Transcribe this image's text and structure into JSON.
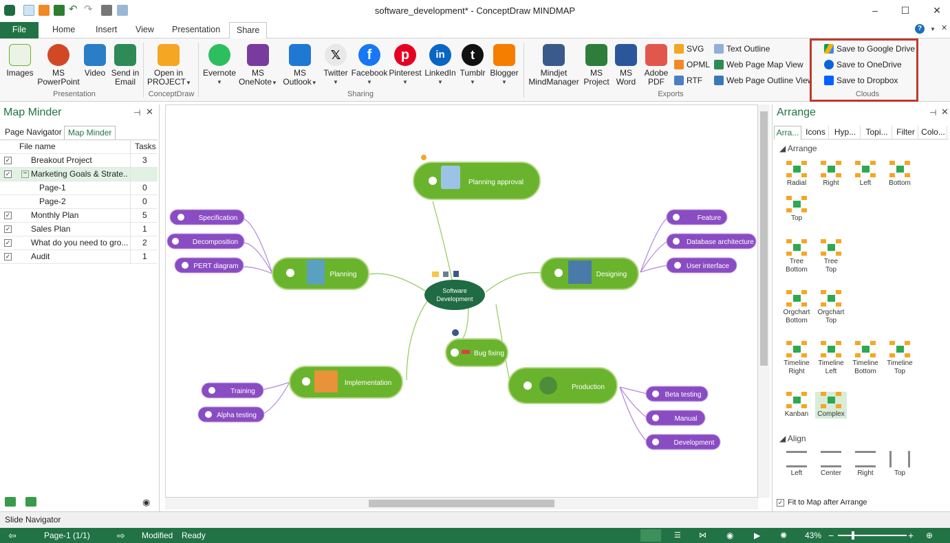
{
  "window": {
    "title": "software_development* - ConceptDraw MINDMAP",
    "minimize": "–",
    "maximize": "☐",
    "close": "✕"
  },
  "tabs": [
    {
      "label": "File"
    },
    {
      "label": "Home"
    },
    {
      "label": "Insert"
    },
    {
      "label": "View"
    },
    {
      "label": "Presentation"
    },
    {
      "label": "Share"
    }
  ],
  "ribbon": {
    "presentation": {
      "group": "Presentation",
      "images": "Images",
      "powerpoint_1": "MS",
      "powerpoint_2": "PowerPoint",
      "video": "Video",
      "email_1": "Send in",
      "email_2": "Email"
    },
    "conceptdraw": {
      "group": "ConceptDraw",
      "project_1": "Open in",
      "project_2": "PROJECT"
    },
    "sharing": {
      "group": "Sharing",
      "evernote": "Evernote",
      "onenote_1": "MS",
      "onenote_2": "OneNote",
      "outlook_1": "MS",
      "outlook_2": "Outlook",
      "twitter": "Twitter",
      "facebook": "Facebook",
      "pinterest": "Pinterest",
      "linkedin": "LinkedIn",
      "tumblr": "Tumblr",
      "blogger": "Blogger"
    },
    "exports": {
      "group": "Exports",
      "mindjet_1": "Mindjet",
      "mindjet_2": "MindManager",
      "project_1": "MS",
      "project_2": "Project",
      "word_1": "MS",
      "word_2": "Word",
      "pdf_1": "Adobe",
      "pdf_2": "PDF",
      "svg": "SVG",
      "opml": "OPML",
      "rtf": "RTF",
      "text_outline": "Text Outline",
      "web_map": "Web Page Map View",
      "web_outline": "Web Page Outline View"
    },
    "clouds": {
      "group": "Clouds",
      "gdrive": "Save to Google Drive",
      "onedrive": "Save to OneDrive",
      "dropbox": "Save to Dropbox"
    }
  },
  "left_panel": {
    "title": "Map Minder",
    "tab_page_navigator": "Page Navigator",
    "tab_map_minder": "Map Minder",
    "col_file": "File name",
    "col_tasks": "Tasks",
    "rows": [
      {
        "name": "Breakout Project",
        "tasks": "3",
        "checked": true
      },
      {
        "name": "Marketing Goals & Strate...",
        "tasks": "",
        "checked": true
      },
      {
        "name": "Page-1",
        "tasks": "0",
        "checked": false
      },
      {
        "name": "Page-2",
        "tasks": "0",
        "checked": false
      },
      {
        "name": "Monthly Plan",
        "tasks": "5",
        "checked": true
      },
      {
        "name": "Sales Plan",
        "tasks": "1",
        "checked": true
      },
      {
        "name": "What do you need to gro...",
        "tasks": "2",
        "checked": true
      },
      {
        "name": "Audit",
        "tasks": "1",
        "checked": true
      }
    ]
  },
  "mindmap": {
    "center": "Software Development",
    "nodes": {
      "approval": "Planning approval",
      "planning": "Planning",
      "designing": "Designing",
      "implementation": "Implementation",
      "bugfixing": "Bug fixing",
      "production": "Production",
      "specification": "Specification",
      "decomposition": "Decomposition",
      "pert": "PERT diagram",
      "feature": "Feature",
      "database": "Database architecture",
      "ui": "User interface",
      "training": "Training",
      "alpha": "Alpha testing",
      "beta": "Beta testing",
      "manual": "Manual",
      "development": "Development"
    }
  },
  "right_panel": {
    "title": "Arrange",
    "tabs": [
      "Arra...",
      "Icons",
      "Hyp...",
      "Topi...",
      "Filter",
      "Colo..."
    ],
    "section_arrange": "Arrange",
    "layouts": [
      {
        "l1": "Radial",
        "l2": ""
      },
      {
        "l1": "Right",
        "l2": ""
      },
      {
        "l1": "Left",
        "l2": ""
      },
      {
        "l1": "Bottom",
        "l2": ""
      },
      {
        "l1": "Top",
        "l2": ""
      },
      {
        "l1": "Tree",
        "l2": "Bottom"
      },
      {
        "l1": "Tree",
        "l2": "Top"
      },
      {
        "l1": "Orgchart",
        "l2": "Bottom"
      },
      {
        "l1": "Orgchart",
        "l2": "Top"
      },
      {
        "l1": "Timeline",
        "l2": "Right"
      },
      {
        "l1": "Timeline",
        "l2": "Left"
      },
      {
        "l1": "Timeline",
        "l2": "Bottom"
      },
      {
        "l1": "Timeline",
        "l2": "Top"
      },
      {
        "l1": "Kanban",
        "l2": ""
      },
      {
        "l1": "Complex",
        "l2": ""
      }
    ],
    "section_align": "Align",
    "align": [
      "Left",
      "Center",
      "Right",
      "Top"
    ],
    "fit_label": "Fit to Map after Arrange"
  },
  "slide_navigator": "Slide Navigator",
  "status": {
    "page": "Page-1 (1/1)",
    "modified": "Modified",
    "ready": "Ready",
    "zoom": "43%"
  },
  "colors": {
    "accent": "#217346",
    "node_green": "#6ab42d",
    "node_purple": "#8a4cc2",
    "center": "#1f6b43",
    "highlight": "#c0392b"
  }
}
